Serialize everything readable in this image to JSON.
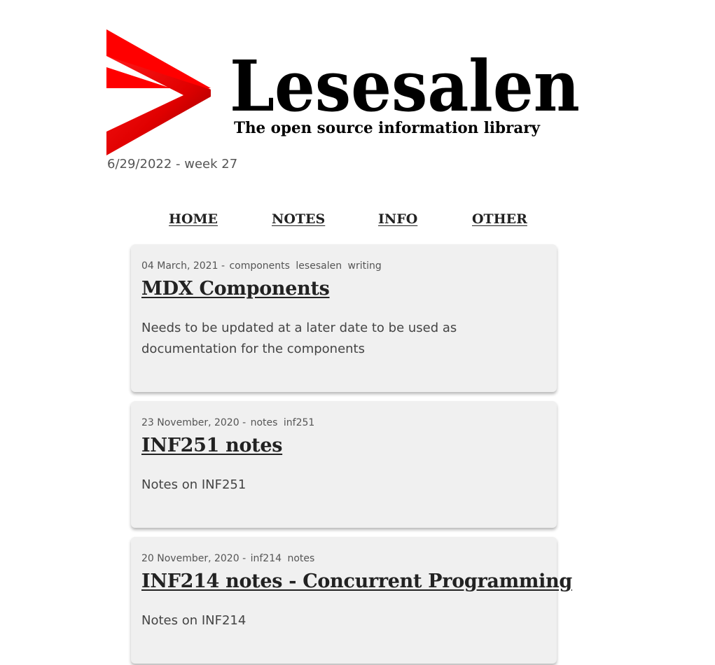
{
  "brand": {
    "name": "Lesesalen",
    "tagline": "The open source information library",
    "colors": {
      "accent": "#e00000",
      "text": "#000000"
    }
  },
  "date_line": "6/29/2022 - week 27",
  "nav": {
    "items": [
      {
        "label": "HOME"
      },
      {
        "label": "NOTES"
      },
      {
        "label": "INFO"
      },
      {
        "label": "OTHER"
      }
    ]
  },
  "posts": [
    {
      "date": "04 March, 2021",
      "separator": "-",
      "tags": [
        "components",
        "lesesalen",
        "writing"
      ],
      "title": "MDX Components",
      "excerpt": "Needs to be updated at a later date to be used as documentation for the components"
    },
    {
      "date": "23 November, 2020",
      "separator": "-",
      "tags": [
        "notes",
        "inf251"
      ],
      "title": "INF251 notes",
      "excerpt": "Notes on INF251"
    },
    {
      "date": "20 November, 2020",
      "separator": "-",
      "tags": [
        "inf214",
        "notes"
      ],
      "title": "INF214 notes - Concurrent Programming",
      "excerpt": "Notes on INF214"
    }
  ]
}
